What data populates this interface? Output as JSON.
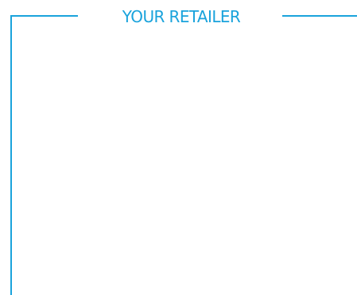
{
  "heading": {
    "text": "YOUR RETAILER"
  },
  "colors": {
    "accent": "#1aa3dc",
    "background": "#ffffff"
  }
}
